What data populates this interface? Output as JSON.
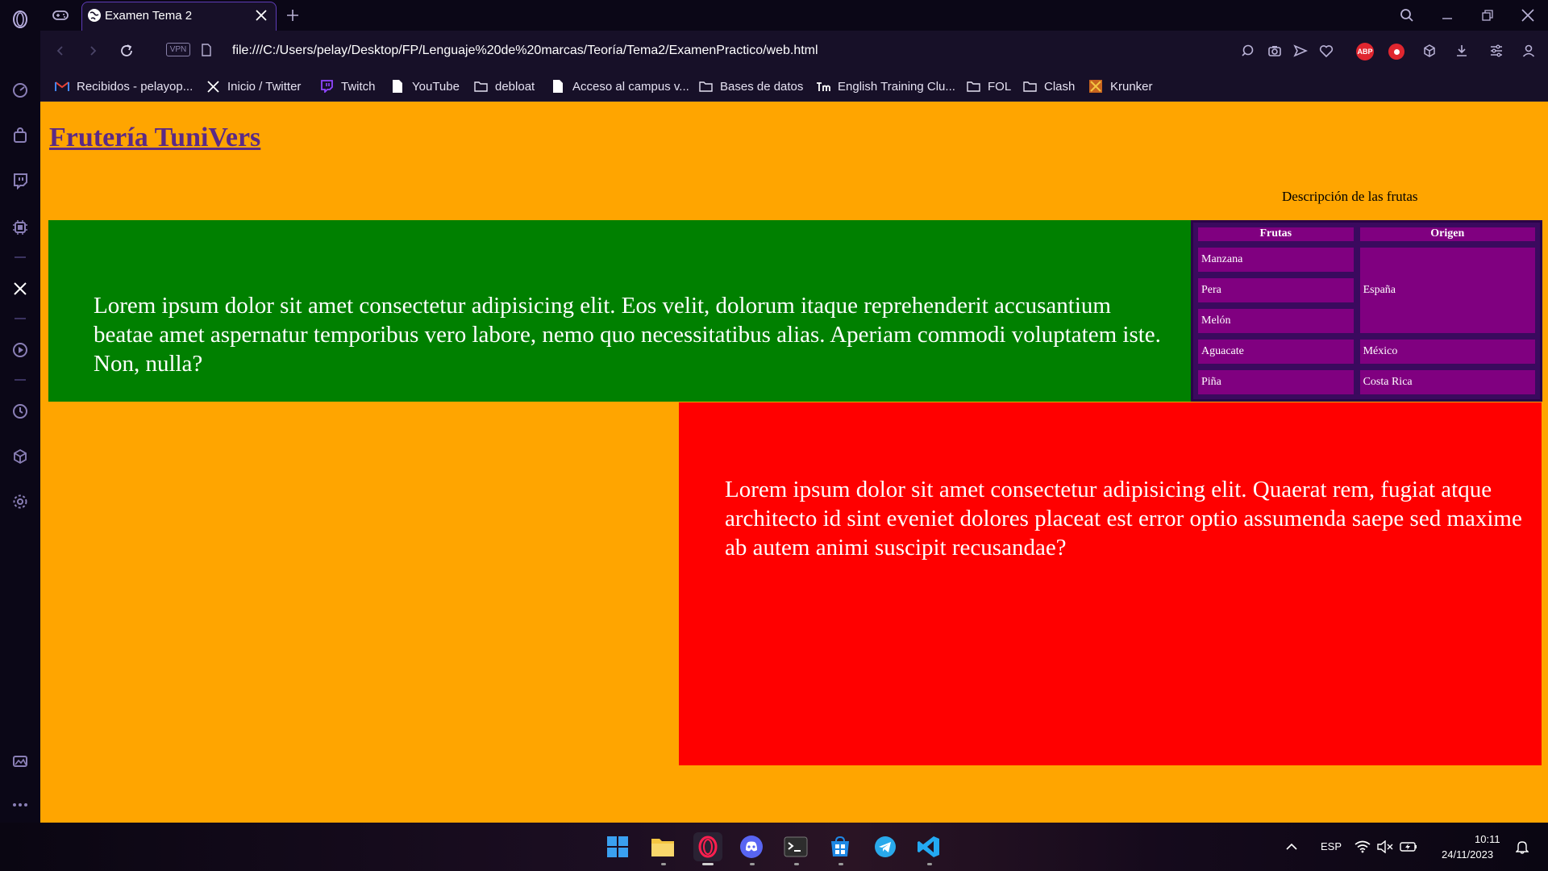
{
  "browser": {
    "tab_title": "Examen Tema 2",
    "url": "file:///C:/Users/pelay/Desktop/FP/Lenguaje%20de%20marcas/Teoría/Tema2/ExamenPractico/web.html",
    "vpn_label": "VPN",
    "adblock_label": "ABP"
  },
  "bookmarks": [
    {
      "label": "Recibidos - pelayop...",
      "icon": "gmail-icon"
    },
    {
      "label": "Inicio / Twitter",
      "icon": "x-icon"
    },
    {
      "label": "Twitch",
      "icon": "twitch-icon"
    },
    {
      "label": "YouTube",
      "icon": "file-icon"
    },
    {
      "label": "debloat",
      "icon": "folder-icon"
    },
    {
      "label": "Acceso al campus v...",
      "icon": "file-icon"
    },
    {
      "label": "Bases de datos",
      "icon": "folder-icon"
    },
    {
      "label": "English Training Clu...",
      "icon": "etc-icon"
    },
    {
      "label": "FOL",
      "icon": "folder-icon"
    },
    {
      "label": "Clash",
      "icon": "folder-icon"
    },
    {
      "label": "Krunker",
      "icon": "krunker-icon"
    }
  ],
  "page": {
    "title": "Frutería TuniVers",
    "table_caption": "Descripción de las frutas",
    "green_text": "Lorem ipsum dolor sit amet consectetur adipisicing elit. Eos velit, dolorum itaque reprehenderit accusantium beataе amet aspernatur temporibus vero labore, nemo quo necessitatibus alias. Aperiam commodi voluptatem iste. Non, nulla?",
    "red_text": "Lorem ipsum dolor sit amet consectetur adipisicing elit. Quaerat rem, fugiat atque architecto id sint eveniet dolores placeat est error optio assumenda saepe sed maxime ab autem animi suscipit recusandae?",
    "table": {
      "headers": [
        "Frutas",
        "Origen"
      ],
      "fruits": [
        "Manzana",
        "Pera",
        "Melón",
        "Aguacate",
        "Piña"
      ],
      "origins": [
        "España",
        "México",
        "Costa Rica"
      ]
    },
    "colors": {
      "background": "#FFA500",
      "green_box": "#008000",
      "red_box": "#FF0000",
      "table_cell": "#800080",
      "title": "#5b2a86"
    }
  },
  "tray": {
    "language": "ESP",
    "time": "10:11",
    "date": "24/11/2023"
  }
}
